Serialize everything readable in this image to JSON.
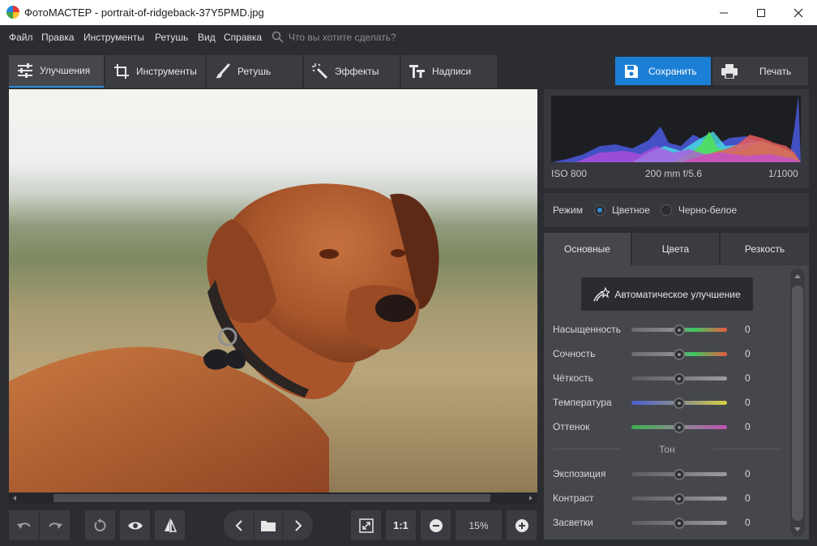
{
  "window": {
    "title": "ФотоМАСТЕР - portrait-of-ridgeback-37Y5PMD.jpg"
  },
  "menu": {
    "items": [
      "Файл",
      "Правка",
      "Инструменты",
      "Ретушь",
      "Вид",
      "Справка"
    ],
    "search_placeholder": "Что вы хотите сделать?"
  },
  "toolbar": {
    "tabs": [
      "Улучшения",
      "Инструменты",
      "Ретушь",
      "Эффекты",
      "Надписи"
    ],
    "save_label": "Сохранить",
    "print_label": "Печать"
  },
  "histogram": {
    "iso": "ISO 800",
    "lens": "200 mm f/5.6",
    "shutter": "1/1000"
  },
  "mode": {
    "label": "Режим",
    "color": "Цветное",
    "bw": "Черно-белое"
  },
  "subtabs": [
    "Основные",
    "Цвета",
    "Резкость"
  ],
  "controls": {
    "auto_label": "Автоматическое улучшение",
    "sliders": [
      {
        "label": "Насыщенность",
        "value": "0"
      },
      {
        "label": "Сочность",
        "value": "0"
      },
      {
        "label": "Чёткость",
        "value": "0"
      },
      {
        "label": "Температура",
        "value": "0"
      },
      {
        "label": "Оттенок",
        "value": "0"
      }
    ],
    "tone_header": "Тон",
    "tone_sliders": [
      {
        "label": "Экспозиция",
        "value": "0"
      },
      {
        "label": "Контраст",
        "value": "0"
      },
      {
        "label": "Засветки",
        "value": "0"
      }
    ]
  },
  "bottom": {
    "ratio_label": "1:1",
    "zoom": "15%"
  }
}
